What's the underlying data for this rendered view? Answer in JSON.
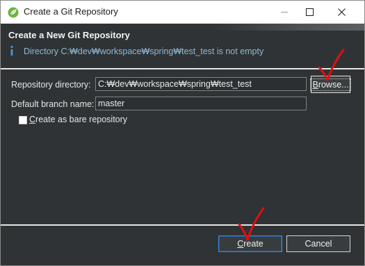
{
  "window": {
    "title": "Create a Git Repository",
    "icon": "spring-leaf-icon"
  },
  "banner": {
    "title": "Create a New Git Repository",
    "message": "Directory C:₩dev₩workspace₩spring₩test_test is not empty",
    "icon": "info-icon"
  },
  "form": {
    "repo_label": "Repository directory:",
    "repo_value": "C:₩dev₩workspace₩spring₩test_test",
    "browse_label": "Browse...",
    "branch_label": "Default branch name:",
    "branch_value": "master",
    "bare_label": "Create as bare repository",
    "bare_checked": false
  },
  "buttons": {
    "create": "Create",
    "cancel": "Cancel"
  },
  "colors": {
    "background": "#2f3335",
    "info_text": "#8fb9d6",
    "default_button_border": "#3d86d9",
    "annotation": "#e01010"
  }
}
